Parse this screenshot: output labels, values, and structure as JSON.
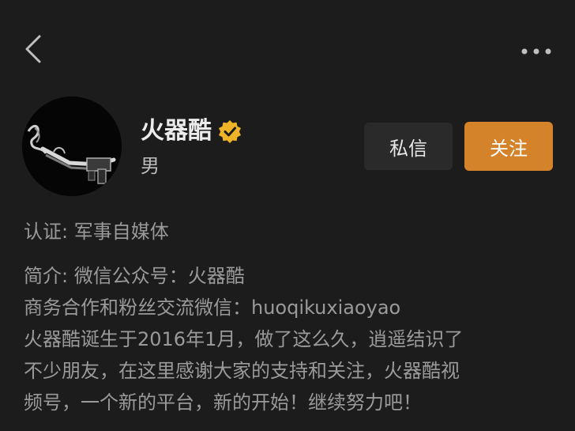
{
  "nav": {
    "back_icon": "chevron-left-icon",
    "more_icon": "more-horizontal-icon"
  },
  "profile": {
    "avatar_icon": "avatar-weapon-image",
    "name": "火器酷",
    "verified_icon": "verified-badge-icon",
    "verified_color": "#f0b429",
    "gender": "男"
  },
  "actions": {
    "message_label": "私信",
    "follow_label": "关注",
    "follow_color": "#d4832b"
  },
  "certification": "认证: 军事自媒体",
  "bio_lines": [
    "简介: 微信公众号：火器酷",
    "商务合作和粉丝交流微信：huoqikuxiaoyao",
    "火器酷诞生于2016年1月，做了这么久，逍遥结识了",
    "不少朋友，在这里感谢大家的支持和关注，火器酷视",
    "频号，一个新的平台，新的开始！继续努力吧！"
  ]
}
